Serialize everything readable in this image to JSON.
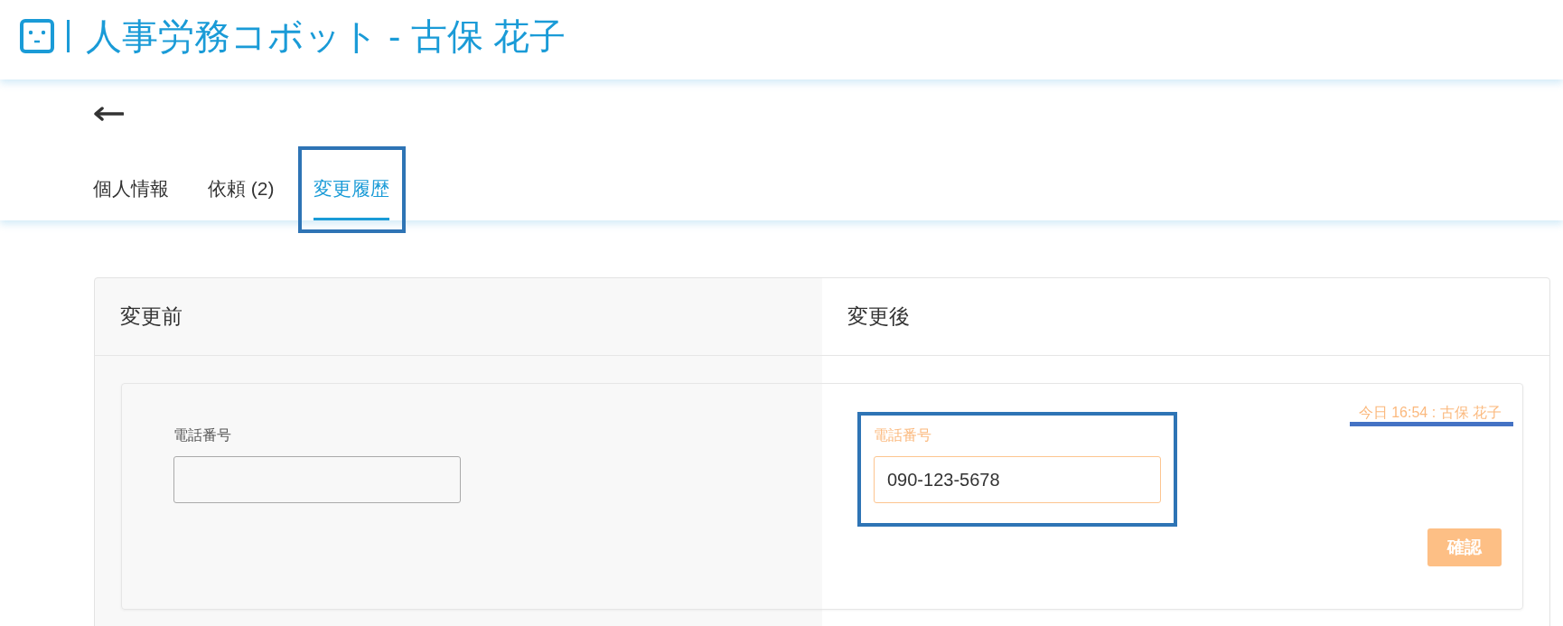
{
  "header": {
    "title": "人事労務コボット - 古保 花子"
  },
  "tabs": [
    {
      "label": "個人情報",
      "selected": false,
      "highlighted": false
    },
    {
      "label": "依頼 (2)",
      "selected": false,
      "highlighted": false
    },
    {
      "label": "変更履歴",
      "selected": true,
      "highlighted": true
    }
  ],
  "columns": [
    {
      "heading": "変更前"
    },
    {
      "heading": "変更後"
    }
  ],
  "change": {
    "before": {
      "label": "電話番号"
    },
    "after": {
      "label": "電話番号",
      "value": "090-123-5678",
      "highlighted": true
    },
    "timestamp": {
      "text": "今日 16:54 : 古保 花子",
      "underlined": true
    },
    "confirm_button": {
      "label": "確認"
    }
  }
}
